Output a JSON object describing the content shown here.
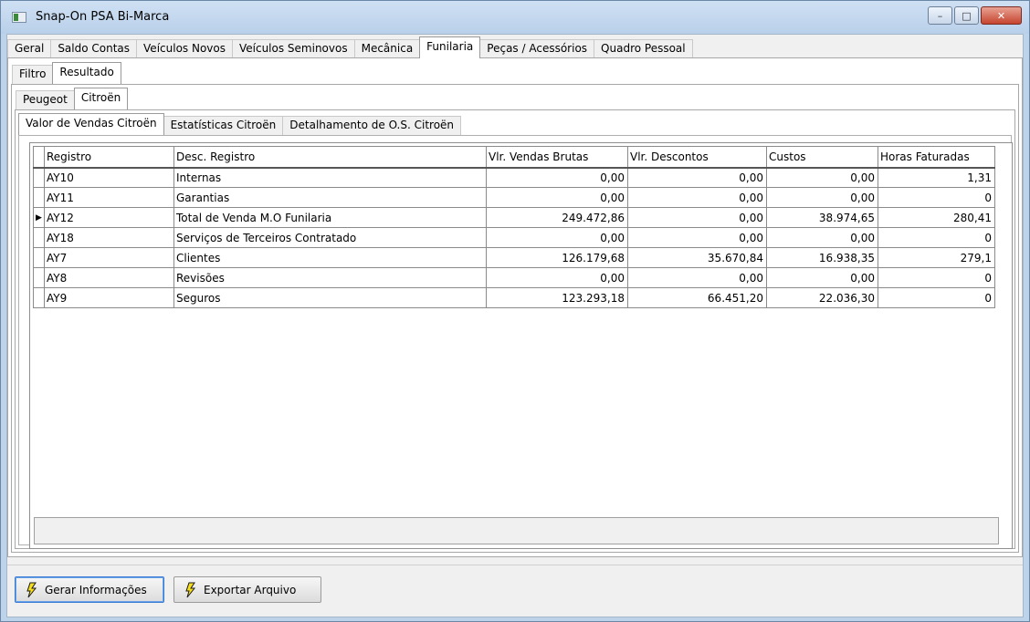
{
  "window": {
    "title": "Snap-On PSA Bi-Marca"
  },
  "main_tabs": [
    "Geral",
    "Saldo Contas",
    "Veículos Novos",
    "Veículos Seminovos",
    "Mecânica",
    "Funilaria",
    "Peças / Acessórios",
    "Quadro Pessoal"
  ],
  "sub_tabs": [
    "Filtro",
    "Resultado"
  ],
  "brand_tabs": [
    "Peugeot",
    "Citroën"
  ],
  "report_tabs": [
    "Valor de Vendas Citroën",
    "Estatísticas Citroën",
    "Detalhamento de O.S. Citroën"
  ],
  "grid": {
    "columns": [
      "Registro",
      "Desc. Registro",
      "Vlr. Vendas Brutas",
      "Vlr. Descontos",
      "Custos",
      "Horas Faturadas"
    ],
    "rows": [
      [
        "AY10",
        "Internas",
        "0,00",
        "0,00",
        "0,00",
        "1,31"
      ],
      [
        "AY11",
        "Garantias",
        "0,00",
        "0,00",
        "0,00",
        "0"
      ],
      [
        "AY12",
        "Total de Venda M.O Funilaria",
        "249.472,86",
        "0,00",
        "38.974,65",
        "280,41"
      ],
      [
        "AY18",
        "Serviços de Terceiros Contratado",
        "0,00",
        "0,00",
        "0,00",
        "0"
      ],
      [
        "AY7",
        "Clientes",
        "126.179,68",
        "35.670,84",
        "16.938,35",
        "279,1"
      ],
      [
        "AY8",
        "Revisões",
        "0,00",
        "0,00",
        "0,00",
        "0"
      ],
      [
        "AY9",
        "Seguros",
        "123.293,18",
        "66.451,20",
        "22.036,30",
        "0"
      ]
    ],
    "current_row_indicator": "▶"
  },
  "buttons": {
    "gerar": "Gerar Informações",
    "exportar": "Exportar Arquivo"
  },
  "window_buttons": {
    "minimize": "–",
    "maximize": "□",
    "close": "✕"
  }
}
